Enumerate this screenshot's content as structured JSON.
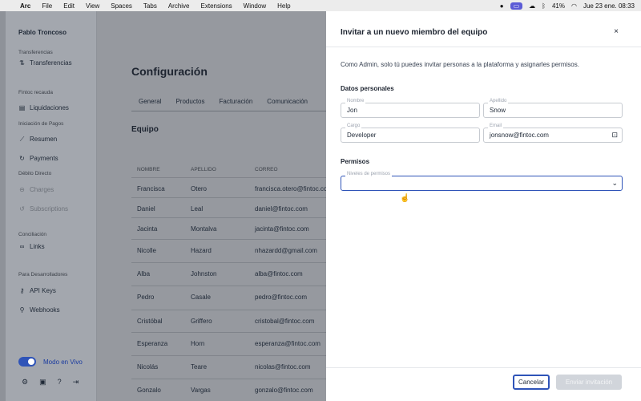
{
  "menubar": {
    "app": "Arc",
    "menus": [
      "File",
      "Edit",
      "View",
      "Spaces",
      "Tabs",
      "Archive",
      "Extensions",
      "Window",
      "Help"
    ],
    "battery": "41%",
    "datetime": "Jue 23 ene.  08:33"
  },
  "sidebar": {
    "user": "Pablo Troncoso",
    "sections": [
      {
        "label": "Transferencias"
      },
      {
        "label": "Fintoc recauda"
      },
      {
        "label": "Iniciación de Pagos"
      },
      {
        "label": "Débito Directo"
      },
      {
        "label": "Conciliación"
      },
      {
        "label": "Para Desarrolladores"
      }
    ],
    "items": [
      {
        "label": "Transferencias",
        "icon": "transfer-icon"
      },
      {
        "label": "Liquidaciones",
        "icon": "document-icon"
      },
      {
        "label": "Resumen",
        "icon": "chart-line-icon"
      },
      {
        "label": "Payments",
        "icon": "payments-icon"
      },
      {
        "label": "Charges",
        "icon": "charges-icon"
      },
      {
        "label": "Subscriptions",
        "icon": "subscriptions-icon"
      },
      {
        "label": "Links",
        "icon": "link-icon"
      },
      {
        "label": "API Keys",
        "icon": "key-icon"
      },
      {
        "label": "Webhooks",
        "icon": "webhook-icon"
      }
    ],
    "live_mode_label": "Modo en Vivo"
  },
  "main": {
    "title": "Configuración",
    "tabs": [
      "General",
      "Productos",
      "Facturación",
      "Comunicación"
    ],
    "section_title": "Equipo",
    "columns": [
      "NOMBRE",
      "APELLIDO",
      "CORREO"
    ],
    "rows": [
      [
        "Francisca",
        "Otero",
        "francisca.otero@fintoc.com"
      ],
      [
        "Daniel",
        "Leal",
        "daniel@fintoc.com"
      ],
      [
        "Jacinta",
        "Montalva",
        "jacinta@fintoc.com"
      ],
      [
        "Nicolle",
        "Hazard",
        "nhazardd@gmail.com"
      ],
      [
        "Alba",
        "Johnston",
        "alba@fintoc.com"
      ],
      [
        "Pedro",
        "Casale",
        "pedro@fintoc.com"
      ],
      [
        "Cristóbal",
        "Griffero",
        "cristobal@fintoc.com"
      ],
      [
        "Esperanza",
        "Horn",
        "esperanza@fintoc.com"
      ],
      [
        "Nicolás",
        "Teare",
        "nicolas@fintoc.com"
      ],
      [
        "Gonzalo",
        "Vargas",
        "gonzalo@fintoc.com"
      ]
    ]
  },
  "panel": {
    "title": "Invitar a un nuevo miembro del equipo",
    "close": "×",
    "description": "Como Admin, solo tú puedes invitar personas a la plataforma y asignarles permisos.",
    "personal_title": "Datos personales",
    "fields": {
      "nombre": {
        "label": "Nombre",
        "value": "Jon"
      },
      "apellido": {
        "label": "Apellido",
        "value": "Snow"
      },
      "cargo": {
        "label": "Cargo",
        "value": "Developer"
      },
      "email": {
        "label": "Email",
        "value": "jonsnow@fintoc.com"
      }
    },
    "permissions_title": "Permisos",
    "permissions_select": {
      "label": "Niveles de permisos",
      "value": ""
    },
    "cancel_label": "Cancelar",
    "send_label": "Enviar invitación"
  },
  "colors": {
    "accent": "#2f54b8",
    "overlay": "#96999f"
  }
}
